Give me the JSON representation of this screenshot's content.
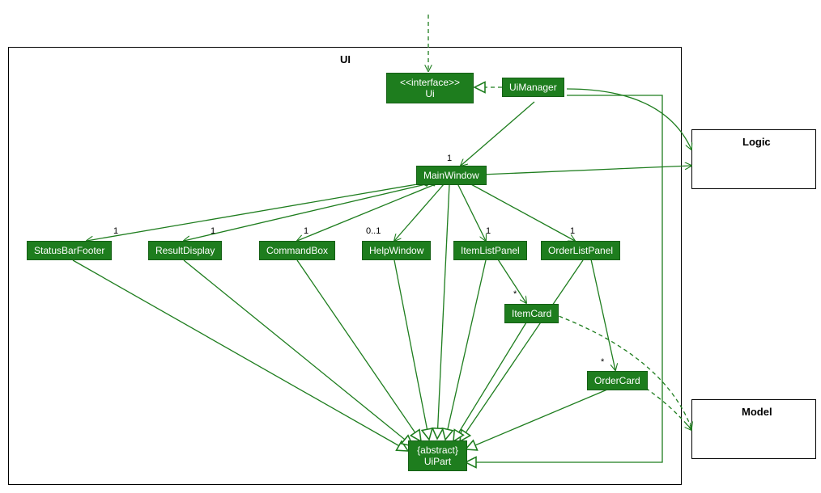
{
  "packages": {
    "ui": {
      "label": "UI"
    },
    "logic": {
      "label": "Logic"
    },
    "model": {
      "label": "Model"
    }
  },
  "nodes": {
    "ui_interface": {
      "line1": "<<interface>>",
      "line2": "Ui"
    },
    "ui_manager": {
      "label": "UiManager"
    },
    "main_window": {
      "label": "MainWindow"
    },
    "status_bar_footer": {
      "label": "StatusBarFooter"
    },
    "result_display": {
      "label": "ResultDisplay"
    },
    "command_box": {
      "label": "CommandBox"
    },
    "help_window": {
      "label": "HelpWindow"
    },
    "item_list_panel": {
      "label": "ItemListPanel"
    },
    "order_list_panel": {
      "label": "OrderListPanel"
    },
    "item_card": {
      "label": "ItemCard"
    },
    "order_card": {
      "label": "OrderCard"
    },
    "ui_part": {
      "line1": "{abstract}",
      "line2": "UiPart"
    }
  },
  "multiplicities": {
    "main_window": "1",
    "status_bar_footer": "1",
    "result_display": "1",
    "command_box": "1",
    "help_window": "0..1",
    "item_list_panel": "1",
    "order_list_panel": "1",
    "item_card": "*",
    "order_card": "*"
  },
  "chart_data": {
    "type": "uml_class_diagram",
    "packages": [
      "UI",
      "Logic",
      "Model"
    ],
    "classes": [
      {
        "name": "Ui",
        "stereotype": "interface",
        "package": "UI"
      },
      {
        "name": "UiManager",
        "package": "UI"
      },
      {
        "name": "MainWindow",
        "package": "UI"
      },
      {
        "name": "StatusBarFooter",
        "package": "UI"
      },
      {
        "name": "ResultDisplay",
        "package": "UI"
      },
      {
        "name": "CommandBox",
        "package": "UI"
      },
      {
        "name": "HelpWindow",
        "package": "UI"
      },
      {
        "name": "ItemListPanel",
        "package": "UI"
      },
      {
        "name": "OrderListPanel",
        "package": "UI"
      },
      {
        "name": "ItemCard",
        "package": "UI"
      },
      {
        "name": "OrderCard",
        "package": "UI"
      },
      {
        "name": "UiPart",
        "stereotype": "abstract",
        "package": "UI"
      },
      {
        "name": "Logic",
        "package": "Logic"
      },
      {
        "name": "Model",
        "package": "Model"
      }
    ],
    "relationships": [
      {
        "from": "(external)",
        "to": "Ui",
        "type": "dependency"
      },
      {
        "from": "UiManager",
        "to": "Ui",
        "type": "realization"
      },
      {
        "from": "UiManager",
        "to": "MainWindow",
        "type": "association",
        "multiplicity": "1"
      },
      {
        "from": "UiManager",
        "to": "Logic",
        "type": "association"
      },
      {
        "from": "MainWindow",
        "to": "Logic",
        "type": "association"
      },
      {
        "from": "MainWindow",
        "to": "StatusBarFooter",
        "type": "composition",
        "multiplicity": "1"
      },
      {
        "from": "MainWindow",
        "to": "ResultDisplay",
        "type": "composition",
        "multiplicity": "1"
      },
      {
        "from": "MainWindow",
        "to": "CommandBox",
        "type": "composition",
        "multiplicity": "1"
      },
      {
        "from": "MainWindow",
        "to": "HelpWindow",
        "type": "composition",
        "multiplicity": "0..1"
      },
      {
        "from": "MainWindow",
        "to": "ItemListPanel",
        "type": "composition",
        "multiplicity": "1"
      },
      {
        "from": "MainWindow",
        "to": "OrderListPanel",
        "type": "composition",
        "multiplicity": "1"
      },
      {
        "from": "ItemListPanel",
        "to": "ItemCard",
        "type": "association",
        "multiplicity": "*"
      },
      {
        "from": "OrderListPanel",
        "to": "OrderCard",
        "type": "association",
        "multiplicity": "*"
      },
      {
        "from": "ItemCard",
        "to": "Model",
        "type": "dependency"
      },
      {
        "from": "OrderCard",
        "to": "Model",
        "type": "dependency"
      },
      {
        "from": "MainWindow",
        "to": "UiPart",
        "type": "generalization"
      },
      {
        "from": "StatusBarFooter",
        "to": "UiPart",
        "type": "generalization"
      },
      {
        "from": "ResultDisplay",
        "to": "UiPart",
        "type": "generalization"
      },
      {
        "from": "CommandBox",
        "to": "UiPart",
        "type": "generalization"
      },
      {
        "from": "HelpWindow",
        "to": "UiPart",
        "type": "generalization"
      },
      {
        "from": "ItemListPanel",
        "to": "UiPart",
        "type": "generalization"
      },
      {
        "from": "OrderListPanel",
        "to": "UiPart",
        "type": "generalization"
      },
      {
        "from": "ItemCard",
        "to": "UiPart",
        "type": "generalization"
      },
      {
        "from": "OrderCard",
        "to": "UiPart",
        "type": "generalization"
      },
      {
        "from": "UiManager",
        "to": "UiPart",
        "type": "generalization"
      }
    ]
  }
}
